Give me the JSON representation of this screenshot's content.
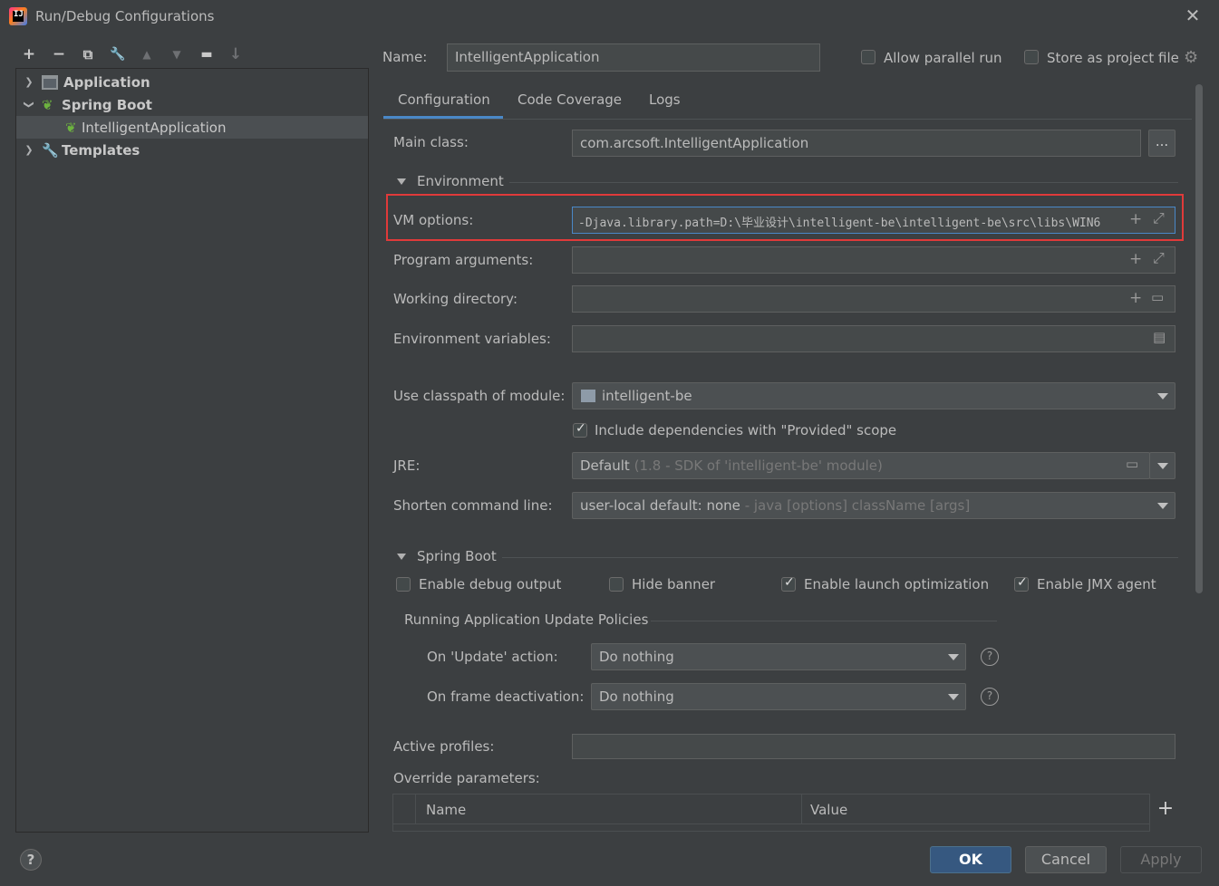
{
  "window": {
    "title": "Run/Debug Configurations"
  },
  "toolbar": {
    "add": "+",
    "remove": "−",
    "copy": "⧉",
    "edit": "🔧",
    "up": "▲",
    "down": "▼",
    "folder": "▬",
    "sort": "↓"
  },
  "tree": {
    "items": [
      {
        "label": "Application",
        "icon": "application-icon"
      },
      {
        "label": "Spring Boot",
        "icon": "spring-boot-icon"
      },
      {
        "label": "IntelligentApplication",
        "icon": "spring-boot-config-icon"
      },
      {
        "label": "Templates",
        "icon": "wrench-icon"
      }
    ]
  },
  "header": {
    "name_label": "Name:",
    "name_value": "IntelligentApplication",
    "allow_parallel_label": "Allow parallel run",
    "store_project_label": "Store as project file"
  },
  "tabs": [
    {
      "label": "Configuration",
      "active": true
    },
    {
      "label": "Code Coverage",
      "active": false
    },
    {
      "label": "Logs",
      "active": false
    }
  ],
  "form": {
    "main_class_label": "Main class:",
    "main_class_value": "com.arcsoft.IntelligentApplication",
    "browse_button": "...",
    "environment_section": "Environment",
    "vm_options_label": "VM options:",
    "vm_options_value": "-Djava.library.path=D:\\毕业设计\\intelligent-be\\intelligent-be\\src\\libs\\WIN6",
    "program_args_label": "Program arguments:",
    "working_dir_label": "Working directory:",
    "env_vars_label": "Environment variables:",
    "classpath_label": "Use classpath of module:",
    "classpath_value": "intelligent-be",
    "include_deps_label": "Include dependencies with \"Provided\" scope",
    "jre_label": "JRE:",
    "jre_value": "Default",
    "jre_hint": "(1.8 - SDK of 'intelligent-be' module)",
    "shorten_label": "Shorten command line:",
    "shorten_value": "user-local default: none",
    "shorten_hint": "- java [options] className [args]"
  },
  "spring_boot": {
    "section": "Spring Boot",
    "enable_debug_label": "Enable debug output",
    "hide_banner_label": "Hide banner",
    "launch_opt_label": "Enable launch optimization",
    "jmx_label": "Enable JMX agent",
    "policies_title": "Running Application Update Policies",
    "on_update_label": "On 'Update' action:",
    "on_update_value": "Do nothing",
    "on_frame_label": "On frame deactivation:",
    "on_frame_value": "Do nothing",
    "active_profiles_label": "Active profiles:",
    "override_label": "Override parameters:",
    "table_headers": [
      "Name",
      "Value"
    ],
    "add_row": "+"
  },
  "footer": {
    "help": "?",
    "ok": "OK",
    "cancel": "Cancel",
    "apply": "Apply"
  },
  "colors": {
    "accent": "#4a88c7",
    "ok_button": "#365880",
    "highlight_box": "#e03a3a",
    "main_class_text": "#e1a245"
  }
}
